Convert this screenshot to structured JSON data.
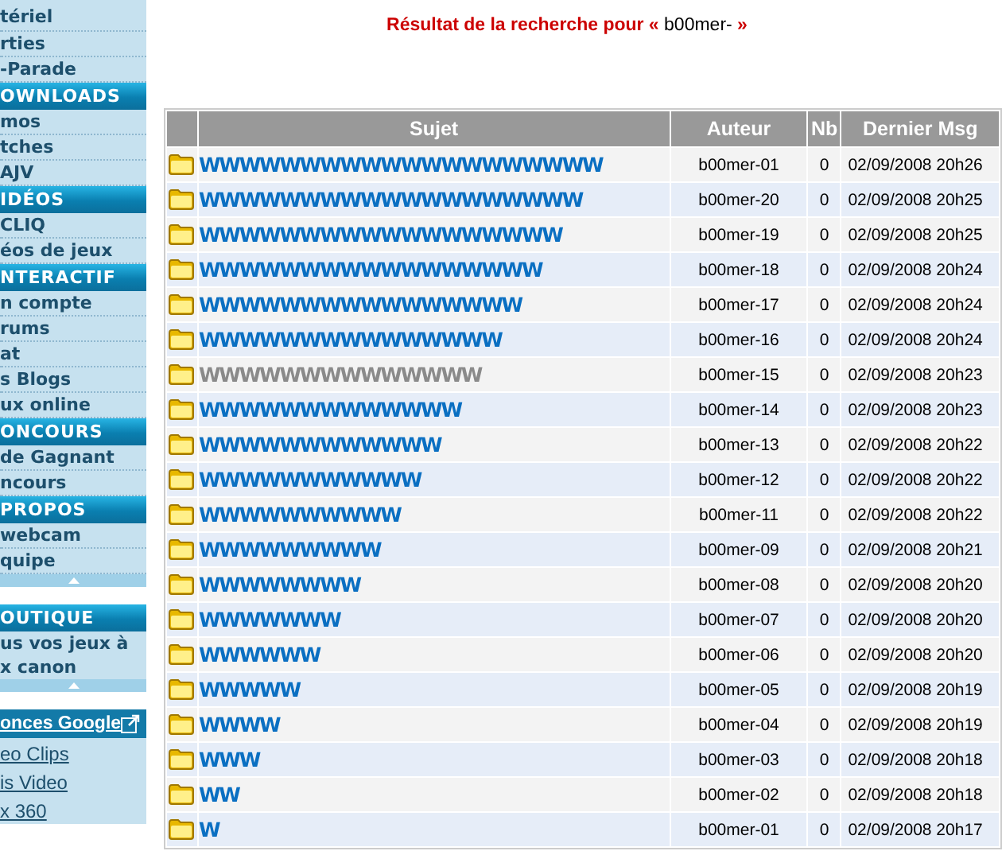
{
  "sidebar": [
    {
      "kind": "link",
      "label": "tériel"
    },
    {
      "kind": "link",
      "label": "rties"
    },
    {
      "kind": "link",
      "label": "-Parade"
    },
    {
      "kind": "header",
      "label": "OWNLOADS"
    },
    {
      "kind": "link",
      "label": "mos"
    },
    {
      "kind": "link",
      "label": "tches"
    },
    {
      "kind": "link",
      "label": "AJV"
    },
    {
      "kind": "header",
      "label": "IDÉOS"
    },
    {
      "kind": "link",
      "label": "CLIQ"
    },
    {
      "kind": "link",
      "label": "éos de jeux"
    },
    {
      "kind": "header",
      "label": "NTERACTIF"
    },
    {
      "kind": "link",
      "label": "n compte"
    },
    {
      "kind": "link",
      "label": "rums"
    },
    {
      "kind": "link",
      "label": "at"
    },
    {
      "kind": "link",
      "label": "s Blogs"
    },
    {
      "kind": "link",
      "label": "ux online"
    },
    {
      "kind": "header",
      "label": "ONCOURS"
    },
    {
      "kind": "link",
      "label": "de Gagnant"
    },
    {
      "kind": "link",
      "label": "ncours"
    },
    {
      "kind": "header",
      "label": "PROPOS"
    },
    {
      "kind": "link",
      "label": "webcam"
    },
    {
      "kind": "link",
      "label": "quipe"
    },
    {
      "kind": "fold"
    },
    {
      "kind": "gap"
    },
    {
      "kind": "header",
      "label": "OUTIQUE"
    },
    {
      "kind": "text",
      "label": "us vos jeux à"
    },
    {
      "kind": "text",
      "label": "x canon"
    },
    {
      "kind": "fold"
    },
    {
      "kind": "gap"
    },
    {
      "kind": "ads",
      "label": "onces Google"
    },
    {
      "kind": "ad",
      "label": "eo Clips"
    },
    {
      "kind": "ad",
      "label": "is Video"
    },
    {
      "kind": "ad",
      "label": "x 360"
    }
  ],
  "heading": {
    "text": "Résultat de la recherche pour «",
    "query": "b00mer-",
    "close": "»"
  },
  "table": {
    "columns": [
      "Sujet",
      "Auteur",
      "Nb",
      "Dernier Msg"
    ],
    "rows": [
      {
        "subject": "WWWWWWWWWWWWWWWWWWWW",
        "author": "b00mer-01",
        "count": "0",
        "date": "02/09/2008 20h26",
        "visited": false
      },
      {
        "subject": "WWWWWWWWWWWWWWWWWWW",
        "author": "b00mer-20",
        "count": "0",
        "date": "02/09/2008 20h25",
        "visited": false
      },
      {
        "subject": "WWWWWWWWWWWWWWWWWW",
        "author": "b00mer-19",
        "count": "0",
        "date": "02/09/2008 20h25",
        "visited": false
      },
      {
        "subject": "WWWWWWWWWWWWWWWWW",
        "author": "b00mer-18",
        "count": "0",
        "date": "02/09/2008 20h24",
        "visited": false
      },
      {
        "subject": "WWWWWWWWWWWWWWWW",
        "author": "b00mer-17",
        "count": "0",
        "date": "02/09/2008 20h24",
        "visited": false
      },
      {
        "subject": "WWWWWWWWWWWWWWW",
        "author": "b00mer-16",
        "count": "0",
        "date": "02/09/2008 20h24",
        "visited": false
      },
      {
        "subject": "WWWWWWWWWWWWWW",
        "author": "b00mer-15",
        "count": "0",
        "date": "02/09/2008 20h23",
        "visited": true
      },
      {
        "subject": "WWWWWWWWWWWWW",
        "author": "b00mer-14",
        "count": "0",
        "date": "02/09/2008 20h23",
        "visited": false
      },
      {
        "subject": "WWWWWWWWWWWW",
        "author": "b00mer-13",
        "count": "0",
        "date": "02/09/2008 20h22",
        "visited": false
      },
      {
        "subject": "WWWWWWWWWWW",
        "author": "b00mer-12",
        "count": "0",
        "date": "02/09/2008 20h22",
        "visited": false
      },
      {
        "subject": "WWWWWWWWWW",
        "author": "b00mer-11",
        "count": "0",
        "date": "02/09/2008 20h22",
        "visited": false
      },
      {
        "subject": "WWWWWWWWW",
        "author": "b00mer-09",
        "count": "0",
        "date": "02/09/2008 20h21",
        "visited": false
      },
      {
        "subject": "WWWWWWWW",
        "author": "b00mer-08",
        "count": "0",
        "date": "02/09/2008 20h20",
        "visited": false
      },
      {
        "subject": "WWWWWWW",
        "author": "b00mer-07",
        "count": "0",
        "date": "02/09/2008 20h20",
        "visited": false
      },
      {
        "subject": "WWWWWW",
        "author": "b00mer-06",
        "count": "0",
        "date": "02/09/2008 20h20",
        "visited": false
      },
      {
        "subject": "WWWWW",
        "author": "b00mer-05",
        "count": "0",
        "date": "02/09/2008 20h19",
        "visited": false
      },
      {
        "subject": "WWWW",
        "author": "b00mer-04",
        "count": "0",
        "date": "02/09/2008 20h19",
        "visited": false
      },
      {
        "subject": "WWW",
        "author": "b00mer-03",
        "count": "0",
        "date": "02/09/2008 20h18",
        "visited": false
      },
      {
        "subject": "WW",
        "author": "b00mer-02",
        "count": "0",
        "date": "02/09/2008 20h18",
        "visited": false
      },
      {
        "subject": "W",
        "author": "b00mer-01",
        "count": "0",
        "date": "02/09/2008 20h17",
        "visited": false
      }
    ]
  }
}
